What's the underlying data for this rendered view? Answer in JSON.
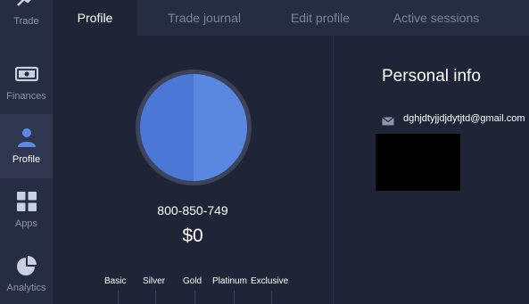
{
  "sidebar": {
    "items": [
      {
        "label": "Trade",
        "icon": "trend-arrow-icon",
        "active": false
      },
      {
        "label": "Finances",
        "icon": "banknote-icon",
        "active": false
      },
      {
        "label": "Profile",
        "icon": "user-icon",
        "active": true
      },
      {
        "label": "Apps",
        "icon": "grid-icon",
        "active": false
      },
      {
        "label": "Analytics",
        "icon": "pie-chart-icon",
        "active": false
      }
    ]
  },
  "tabs": [
    {
      "label": "Profile",
      "active": true
    },
    {
      "label": "Trade journal",
      "active": false
    },
    {
      "label": "Edit profile",
      "active": false
    },
    {
      "label": "Active sessions",
      "active": false
    }
  ],
  "profile": {
    "user_id": "800-850-749",
    "balance": "$0",
    "levels": [
      "Basic",
      "Silver",
      "Gold",
      "Platinum",
      "Exclusive"
    ]
  },
  "personal_info": {
    "title": "Personal info",
    "email": "dghjdtyjjdjdytjtd@gmail.com"
  },
  "colors": {
    "sidebar_bg": "#262c41",
    "page_bg": "#1f2437",
    "avatar_blue": "#4b78d6",
    "active_text": "#ffffff",
    "muted_text": "#7d859c"
  }
}
